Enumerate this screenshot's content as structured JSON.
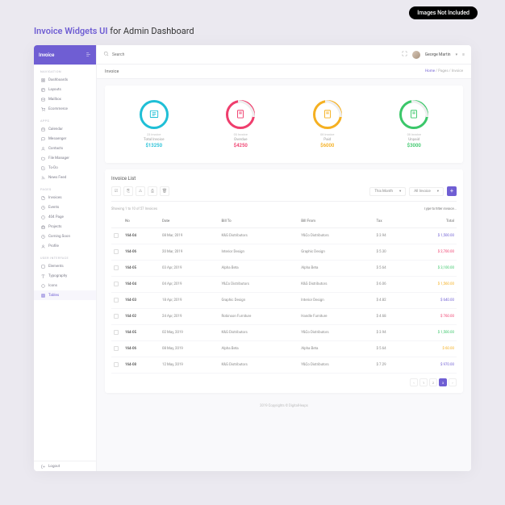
{
  "badge_notincluded": "Images Not Included",
  "promo": {
    "prefix": "Invoice Widgets UI",
    "suffix": " for Admin Dashboard"
  },
  "brand": "Invoice",
  "header": {
    "search_placeholder": "Search",
    "user_name": "George Martin"
  },
  "page": {
    "title": "Invoice",
    "crumbs": {
      "home": "Home",
      "mid": "Pages",
      "last": "Invoice"
    }
  },
  "sidebar": {
    "sections": [
      {
        "heading": "NAVIGATION",
        "items": [
          {
            "label": "Dashboards"
          },
          {
            "label": "Layouts"
          },
          {
            "label": "Mailbox"
          },
          {
            "label": "Ecommerce"
          }
        ]
      },
      {
        "heading": "APPS",
        "items": [
          {
            "label": "Calendar"
          },
          {
            "label": "Messenger"
          },
          {
            "label": "Contacts"
          },
          {
            "label": "File Manager"
          },
          {
            "label": "To-Do"
          },
          {
            "label": "News Feed"
          }
        ]
      },
      {
        "heading": "PAGES",
        "items": [
          {
            "label": "Invoices"
          },
          {
            "label": "Events"
          },
          {
            "label": "404 Page"
          },
          {
            "label": "Projects"
          },
          {
            "label": "Coming Soon"
          },
          {
            "label": "Profile"
          }
        ]
      },
      {
        "heading": "USER INTERFACE",
        "items": [
          {
            "label": "Elements"
          },
          {
            "label": "Typography"
          },
          {
            "label": "Icons"
          },
          {
            "label": "Tables"
          }
        ]
      }
    ],
    "logout": "Logout"
  },
  "widgets": [
    {
      "count_label": "23 Invoice",
      "name": "Total Invoice",
      "value": "$13250",
      "color": "#1fbfd6"
    },
    {
      "count_label": "03 Invoice",
      "name": "Overdue",
      "value": "$4250",
      "color": "#ef3e6d"
    },
    {
      "count_label": "08 Invoice",
      "name": "Paid",
      "value": "$6000",
      "color": "#f5b021"
    },
    {
      "count_label": "08 Invoice",
      "name": "Unpaid",
      "value": "$3000",
      "color": "#3bc76a"
    }
  ],
  "list": {
    "title": "Invoice List",
    "showing": "Showing 1 to 10 of 57 Invoices",
    "filter_placeholder": "Type to filter invoice...",
    "select_period": "This Month",
    "select_status": "All Invoice",
    "columns": [
      "No",
      "Date",
      "Bill To",
      "Bill From",
      "Tax",
      "Total"
    ],
    "rows": [
      {
        "no": "164-04",
        "date": "08 Mar, 2019",
        "to": "K&G Distributors",
        "from": "Y&Co Distributors",
        "tax": "$ 3.94",
        "total": "$ 1,500.00",
        "total_color": "#6f5ed3"
      },
      {
        "no": "164-06",
        "date": "20 Mar, 2019",
        "to": "Interior Design",
        "from": "Graphic Design",
        "tax": "$ 5.30",
        "total": "$ 2,700.00",
        "total_color": "#ef3e6d"
      },
      {
        "no": "164-05",
        "date": "03 Apr, 2019",
        "to": "Alpha Beta",
        "from": "Alpha Beta",
        "tax": "$ 5.64",
        "total": "$ 3,100.00",
        "total_color": "#3bc76a"
      },
      {
        "no": "164-04",
        "date": "04 Apr, 2019",
        "to": "Y&Co Distributors",
        "from": "K&G Distributors",
        "tax": "$ 6.06",
        "total": "$ 1,560.00",
        "total_color": "#f5b021"
      },
      {
        "no": "164-03",
        "date": "18 Apr, 2019",
        "to": "Graphic Design",
        "from": "Interior Design",
        "tax": "$ 4.82",
        "total": "$ 640.00",
        "total_color": "#6f5ed3"
      },
      {
        "no": "164-02",
        "date": "24 Apr, 2019",
        "to": "Robinson Furniture",
        "from": "Handle Furniture",
        "tax": "$ 4.68",
        "total": "$ 760.00",
        "total_color": "#ef3e6d"
      },
      {
        "no": "164-05",
        "date": "02 May, 2019",
        "to": "K&G Distributors",
        "from": "Y&Co Distributors",
        "tax": "$ 3.94",
        "total": "$ 1,500.00",
        "total_color": "#3bc76a"
      },
      {
        "no": "164-06",
        "date": "08 May, 2019",
        "to": "Alpha Beta",
        "from": "Alpha Beta",
        "tax": "$ 5.64",
        "total": "$ 60.00",
        "total_color": "#f5b021"
      },
      {
        "no": "164-08",
        "date": "12 May, 2019",
        "to": "K&G Distributors",
        "from": "Y&Co Distributors",
        "tax": "$ 7.29",
        "total": "$ 970.00",
        "total_color": "#6f5ed3"
      }
    ],
    "pages": [
      "‹",
      "1",
      "2",
      "3",
      "›"
    ]
  },
  "footer": "2019 Copyrights © DigitalHeaps"
}
